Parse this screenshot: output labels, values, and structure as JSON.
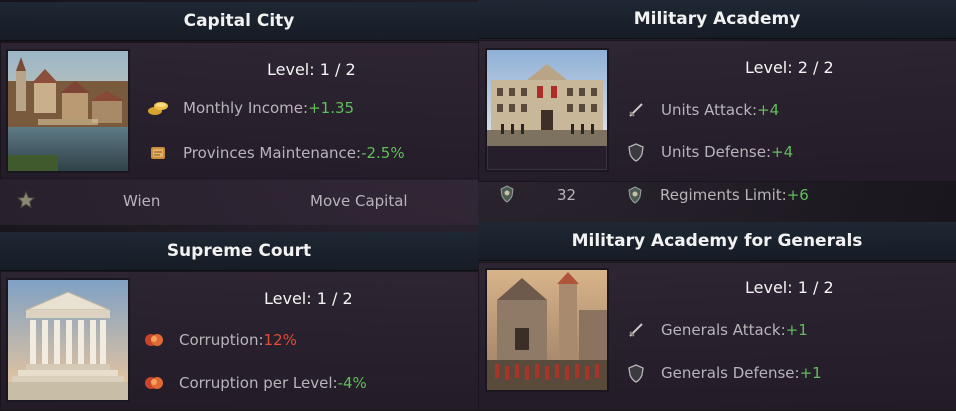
{
  "capital": {
    "title": "Capital City",
    "level": "Level: 1 / 2",
    "stats": [
      {
        "label": "Monthly Income: ",
        "value": "+1.35",
        "icon": "coins-icon"
      },
      {
        "label": "Provinces Maintenance: ",
        "value": "-2.5%",
        "icon": "scroll-icon"
      }
    ],
    "city_name": "Wien",
    "move_label": "Move Capital"
  },
  "court": {
    "title": "Supreme Court",
    "level": "Level: 1 / 2",
    "stats": [
      {
        "label": "Corruption: ",
        "value": "12%",
        "icon": "corruption-icon"
      },
      {
        "label": "Corruption per Level: ",
        "value": "-4%",
        "icon": "corruption-icon"
      }
    ]
  },
  "academy": {
    "title": "Military Academy",
    "level": "Level: 2 / 2",
    "stats": [
      {
        "label": "Units Attack: ",
        "value": "+4",
        "icon": "sword-icon"
      },
      {
        "label": "Units Defense: ",
        "value": "+4",
        "icon": "shield-icon"
      },
      {
        "label": "Regiments Limit: ",
        "value": "+6",
        "icon": "regiment-icon"
      }
    ],
    "count": "32"
  },
  "generals": {
    "title": "Military Academy for Generals",
    "level": "Level: 1 / 2",
    "stats": [
      {
        "label": "Generals Attack: ",
        "value": "+1",
        "icon": "sword-icon"
      },
      {
        "label": "Generals Defense: ",
        "value": "+1",
        "icon": "shield-icon"
      }
    ]
  },
  "colors": {
    "positive": "#5fbf5a",
    "negative": "#e04b3a",
    "title_bar": "#1e2834"
  }
}
